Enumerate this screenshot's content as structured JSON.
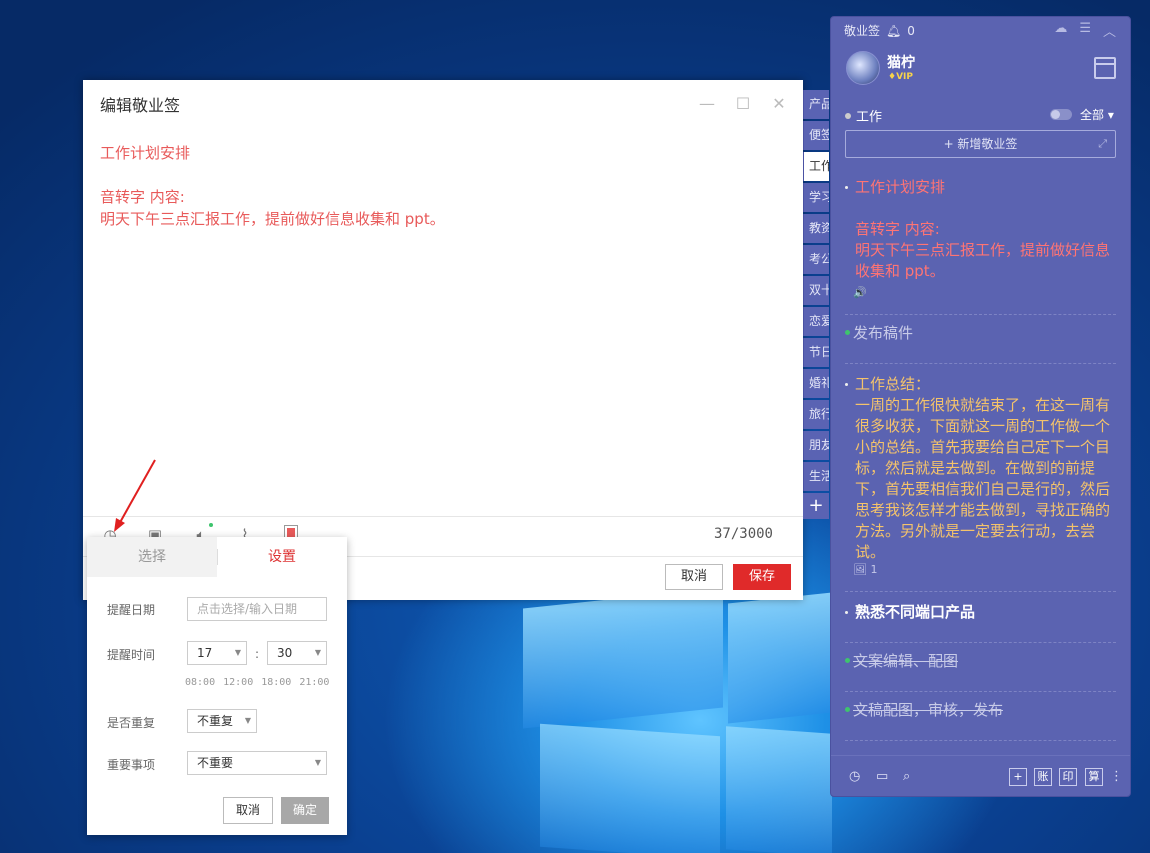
{
  "editor": {
    "title": "编辑敬业签",
    "content_lines": [
      "工作计划安排",
      "",
      "音转字 内容:",
      "明天下午三点汇报工作，提前做好信息收集和 ppt。"
    ],
    "counter": "37/3000",
    "cancel_label": "取消",
    "save_label": "保存"
  },
  "categories": {
    "tabs": [
      "产品",
      "便签",
      "工作",
      "学习",
      "教资",
      "考公",
      "双十",
      "恋爱",
      "节日",
      "婚礼",
      "旅行",
      "朋友",
      "生活"
    ],
    "active_index": 2,
    "add_label": "+"
  },
  "reminder": {
    "tabs": [
      "选择",
      "设置"
    ],
    "active_tab": "设置",
    "date_label": "提醒日期",
    "date_placeholder": "点击选择/输入日期",
    "time_label": "提醒时间",
    "hour": "17",
    "minute": "30",
    "colon": ":",
    "quick_times": [
      "08:00",
      "12:00",
      "18:00",
      "21:00"
    ],
    "repeat_label": "是否重复",
    "repeat_value": "不重复",
    "importance_label": "重要事项",
    "importance_value": "不重要",
    "cancel_label": "取消",
    "confirm_label": "确定"
  },
  "panel": {
    "app_name": "敬业签",
    "bell_count": "0",
    "user_name": "猫柠",
    "vip_label": "VIP",
    "category": "工作",
    "filter": "全部",
    "new_note_label": "+ 新增敬业签",
    "notes": [
      {
        "lines": [
          "工作计划安排",
          "",
          "音转字 内容:",
          "明天下午三点汇报工作，提前做好信息收集和 ppt。"
        ],
        "meta": "🔊"
      },
      {
        "lines": [
          "发布稿件"
        ]
      },
      {
        "lines": [
          "工作总结：",
          "一周的工作很快就结束了，在这一周有很多收获，下面就这一周的工作做一个小的总结。首先我要给自己定下一个目标，然后就是去做到。在做到的前提下，首先要相信我们自己是行的，然后思考我该怎样才能去做到，寻找正确的方法。另外就是一定要去行动，去尝试。"
        ],
        "meta": "🖼 1"
      },
      {
        "lines": [
          "熟悉不同端口产品"
        ]
      },
      {
        "lines": [
          "文案编辑、配图"
        ]
      },
      {
        "lines": [
          "文稿配图，审核，发布"
        ]
      }
    ],
    "bottom_boxes": [
      "+",
      "账",
      "印",
      "算"
    ]
  },
  "colors": {
    "panel_bg": "#5b63b1",
    "accent_red": "#e02a2a",
    "note_red": "#ff7474",
    "note_gold": "#f4c36b",
    "done_green": "#3ec46d"
  }
}
